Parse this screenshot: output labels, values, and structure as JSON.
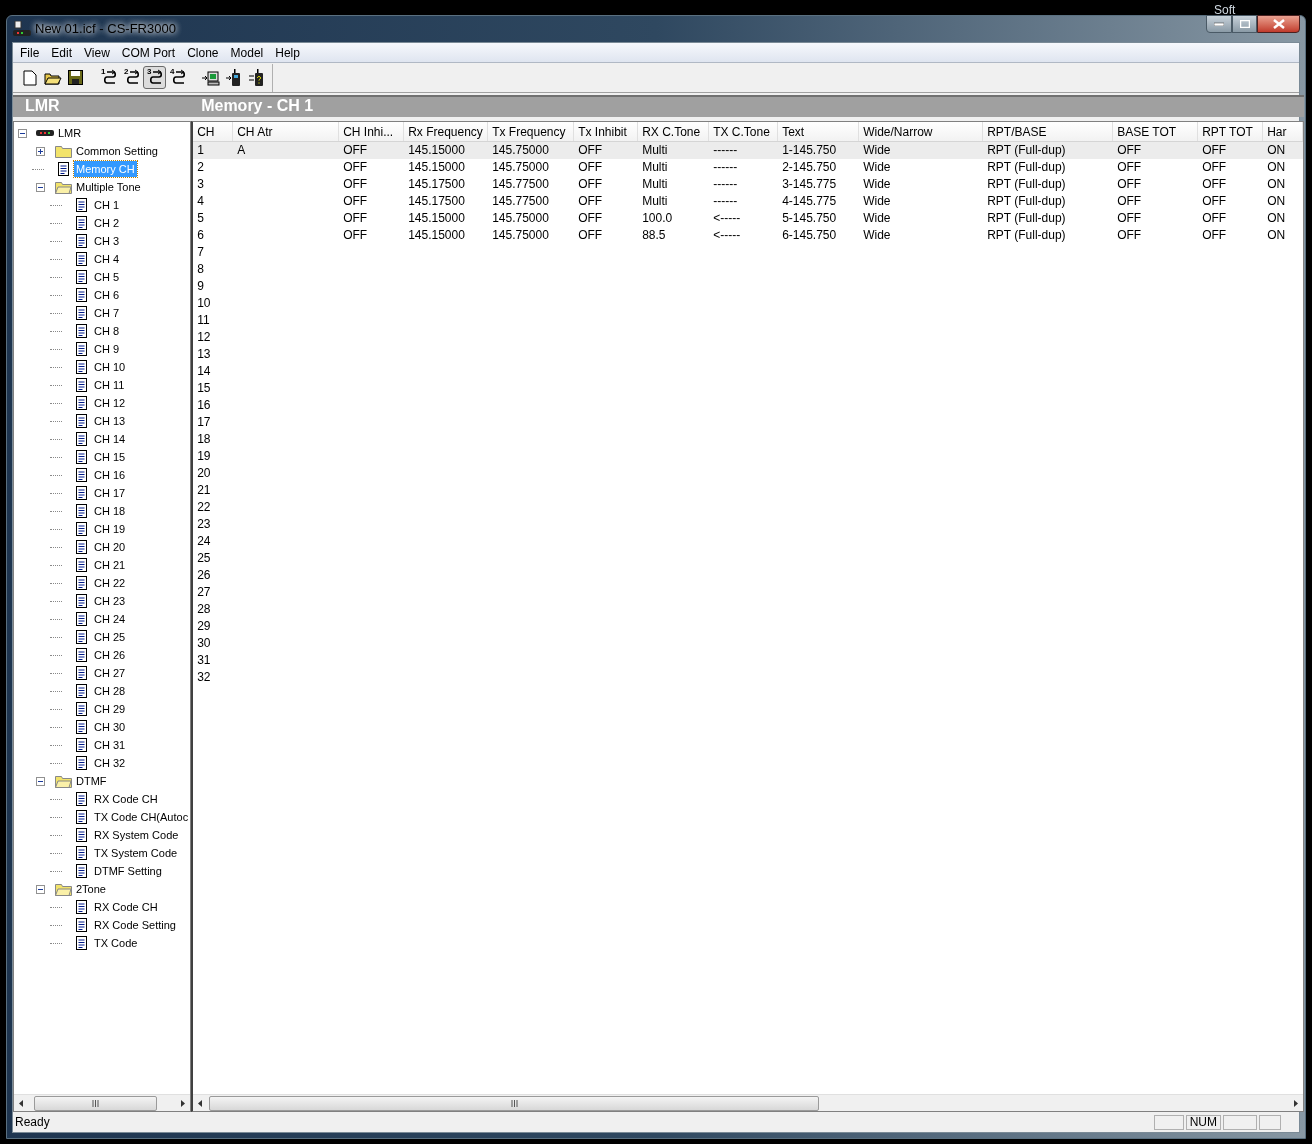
{
  "desktop_text": "Soft",
  "window": {
    "title": "New 01.icf - CS-FR3000"
  },
  "menu": [
    "File",
    "Edit",
    "View",
    "COM Port",
    "Clone",
    "Model",
    "Help"
  ],
  "toolbar": [
    {
      "kind": "new",
      "pressed": false
    },
    {
      "kind": "open",
      "pressed": false
    },
    {
      "kind": "save",
      "pressed": false
    },
    {
      "kind": "clone",
      "number": "1",
      "pressed": false
    },
    {
      "kind": "clone",
      "number": "2",
      "pressed": false
    },
    {
      "kind": "clone",
      "number": "3",
      "pressed": true
    },
    {
      "kind": "clone",
      "number": "4",
      "pressed": false
    },
    {
      "kind": "pc",
      "pressed": false
    },
    {
      "kind": "radio",
      "pressed": false
    },
    {
      "kind": "radio-query",
      "pressed": false
    }
  ],
  "tree_panel": {
    "title": "LMR"
  },
  "tree": [
    {
      "label": "LMR",
      "kind": "device",
      "expanded": true,
      "selected": false,
      "children": [
        {
          "label": "Common Setting",
          "kind": "folder",
          "expanded": false,
          "selected": false
        },
        {
          "label": "Memory CH",
          "kind": "page",
          "selected": true
        },
        {
          "label": "Multiple Tone",
          "kind": "folder",
          "expanded": true,
          "selected": false,
          "children": [
            {
              "label": "CH 1",
              "kind": "page",
              "selected": false
            },
            {
              "label": "CH 2",
              "kind": "page",
              "selected": false
            },
            {
              "label": "CH 3",
              "kind": "page",
              "selected": false
            },
            {
              "label": "CH 4",
              "kind": "page",
              "selected": false
            },
            {
              "label": "CH 5",
              "kind": "page",
              "selected": false
            },
            {
              "label": "CH 6",
              "kind": "page",
              "selected": false
            },
            {
              "label": "CH 7",
              "kind": "page",
              "selected": false
            },
            {
              "label": "CH 8",
              "kind": "page",
              "selected": false
            },
            {
              "label": "CH 9",
              "kind": "page",
              "selected": false
            },
            {
              "label": "CH 10",
              "kind": "page",
              "selected": false
            },
            {
              "label": "CH 11",
              "kind": "page",
              "selected": false
            },
            {
              "label": "CH 12",
              "kind": "page",
              "selected": false
            },
            {
              "label": "CH 13",
              "kind": "page",
              "selected": false
            },
            {
              "label": "CH 14",
              "kind": "page",
              "selected": false
            },
            {
              "label": "CH 15",
              "kind": "page",
              "selected": false
            },
            {
              "label": "CH 16",
              "kind": "page",
              "selected": false
            },
            {
              "label": "CH 17",
              "kind": "page",
              "selected": false
            },
            {
              "label": "CH 18",
              "kind": "page",
              "selected": false
            },
            {
              "label": "CH 19",
              "kind": "page",
              "selected": false
            },
            {
              "label": "CH 20",
              "kind": "page",
              "selected": false
            },
            {
              "label": "CH 21",
              "kind": "page",
              "selected": false
            },
            {
              "label": "CH 22",
              "kind": "page",
              "selected": false
            },
            {
              "label": "CH 23",
              "kind": "page",
              "selected": false
            },
            {
              "label": "CH 24",
              "kind": "page",
              "selected": false
            },
            {
              "label": "CH 25",
              "kind": "page",
              "selected": false
            },
            {
              "label": "CH 26",
              "kind": "page",
              "selected": false
            },
            {
              "label": "CH 27",
              "kind": "page",
              "selected": false
            },
            {
              "label": "CH 28",
              "kind": "page",
              "selected": false
            },
            {
              "label": "CH 29",
              "kind": "page",
              "selected": false
            },
            {
              "label": "CH 30",
              "kind": "page",
              "selected": false
            },
            {
              "label": "CH 31",
              "kind": "page",
              "selected": false
            },
            {
              "label": "CH 32",
              "kind": "page",
              "selected": false
            }
          ]
        },
        {
          "label": "DTMF",
          "kind": "folder",
          "expanded": true,
          "selected": false,
          "children": [
            {
              "label": "RX Code CH",
              "kind": "page",
              "selected": false
            },
            {
              "label": "TX Code CH(Autoc",
              "kind": "page",
              "selected": false
            },
            {
              "label": "RX System Code",
              "kind": "page",
              "selected": false
            },
            {
              "label": "TX System Code",
              "kind": "page",
              "selected": false
            },
            {
              "label": "DTMF Setting",
              "kind": "page",
              "selected": false
            }
          ]
        },
        {
          "label": "2Tone",
          "kind": "folder",
          "expanded": true,
          "selected": false,
          "children": [
            {
              "label": "RX Code CH",
              "kind": "page",
              "selected": false
            },
            {
              "label": "RX Code Setting",
              "kind": "page",
              "selected": false
            },
            {
              "label": "TX Code",
              "kind": "page",
              "selected": false
            }
          ]
        }
      ]
    }
  ],
  "table_panel": {
    "title": "Memory - CH 1"
  },
  "table": {
    "columns": [
      "CH",
      "CH Atr",
      "CH Inhi...",
      "Rx Frequency",
      "Tx Frequency",
      "Tx Inhibit",
      "RX C.Tone",
      "TX C.Tone",
      "Text",
      "Wide/Narrow",
      "RPT/BASE",
      "BASE TOT",
      "RPT TOT",
      "Har"
    ],
    "rows": [
      {
        "selected": true,
        "cells": [
          "1",
          "A",
          "OFF",
          "145.15000",
          "145.75000",
          "OFF",
          "Multi",
          "------",
          "1-145.750",
          "Wide",
          "RPT (Full-dup)",
          "OFF",
          "OFF",
          "ON"
        ]
      },
      {
        "selected": false,
        "cells": [
          "2",
          "",
          "OFF",
          "145.15000",
          "145.75000",
          "OFF",
          "Multi",
          "------",
          "2-145.750",
          "Wide",
          "RPT (Full-dup)",
          "OFF",
          "OFF",
          "ON"
        ]
      },
      {
        "selected": false,
        "cells": [
          "3",
          "",
          "OFF",
          "145.17500",
          "145.77500",
          "OFF",
          "Multi",
          "------",
          "3-145.775",
          "Wide",
          "RPT (Full-dup)",
          "OFF",
          "OFF",
          "ON"
        ]
      },
      {
        "selected": false,
        "cells": [
          "4",
          "",
          "OFF",
          "145.17500",
          "145.77500",
          "OFF",
          "Multi",
          "------",
          "4-145.775",
          "Wide",
          "RPT (Full-dup)",
          "OFF",
          "OFF",
          "ON"
        ]
      },
      {
        "selected": false,
        "cells": [
          "5",
          "",
          "OFF",
          "145.15000",
          "145.75000",
          "OFF",
          "100.0",
          "<-----",
          "5-145.750",
          "Wide",
          "RPT (Full-dup)",
          "OFF",
          "OFF",
          "ON"
        ]
      },
      {
        "selected": false,
        "cells": [
          "6",
          "",
          "OFF",
          "145.15000",
          "145.75000",
          "OFF",
          "88.5",
          "<-----",
          "6-145.750",
          "Wide",
          "RPT (Full-dup)",
          "OFF",
          "OFF",
          "ON"
        ]
      },
      {
        "selected": false,
        "cells": [
          "7"
        ]
      },
      {
        "selected": false,
        "cells": [
          "8"
        ]
      },
      {
        "selected": false,
        "cells": [
          "9"
        ]
      },
      {
        "selected": false,
        "cells": [
          "10"
        ]
      },
      {
        "selected": false,
        "cells": [
          "11"
        ]
      },
      {
        "selected": false,
        "cells": [
          "12"
        ]
      },
      {
        "selected": false,
        "cells": [
          "13"
        ]
      },
      {
        "selected": false,
        "cells": [
          "14"
        ]
      },
      {
        "selected": false,
        "cells": [
          "15"
        ]
      },
      {
        "selected": false,
        "cells": [
          "16"
        ]
      },
      {
        "selected": false,
        "cells": [
          "17"
        ]
      },
      {
        "selected": false,
        "cells": [
          "18"
        ]
      },
      {
        "selected": false,
        "cells": [
          "19"
        ]
      },
      {
        "selected": false,
        "cells": [
          "20"
        ]
      },
      {
        "selected": false,
        "cells": [
          "21"
        ]
      },
      {
        "selected": false,
        "cells": [
          "22"
        ]
      },
      {
        "selected": false,
        "cells": [
          "23"
        ]
      },
      {
        "selected": false,
        "cells": [
          "24"
        ]
      },
      {
        "selected": false,
        "cells": [
          "25"
        ]
      },
      {
        "selected": false,
        "cells": [
          "26"
        ]
      },
      {
        "selected": false,
        "cells": [
          "27"
        ]
      },
      {
        "selected": false,
        "cells": [
          "28"
        ]
      },
      {
        "selected": false,
        "cells": [
          "29"
        ]
      },
      {
        "selected": false,
        "cells": [
          "30"
        ]
      },
      {
        "selected": false,
        "cells": [
          "31"
        ]
      },
      {
        "selected": false,
        "cells": [
          "32"
        ]
      }
    ]
  },
  "status_bar": {
    "text": "Ready",
    "indicators": [
      "NUM"
    ]
  }
}
